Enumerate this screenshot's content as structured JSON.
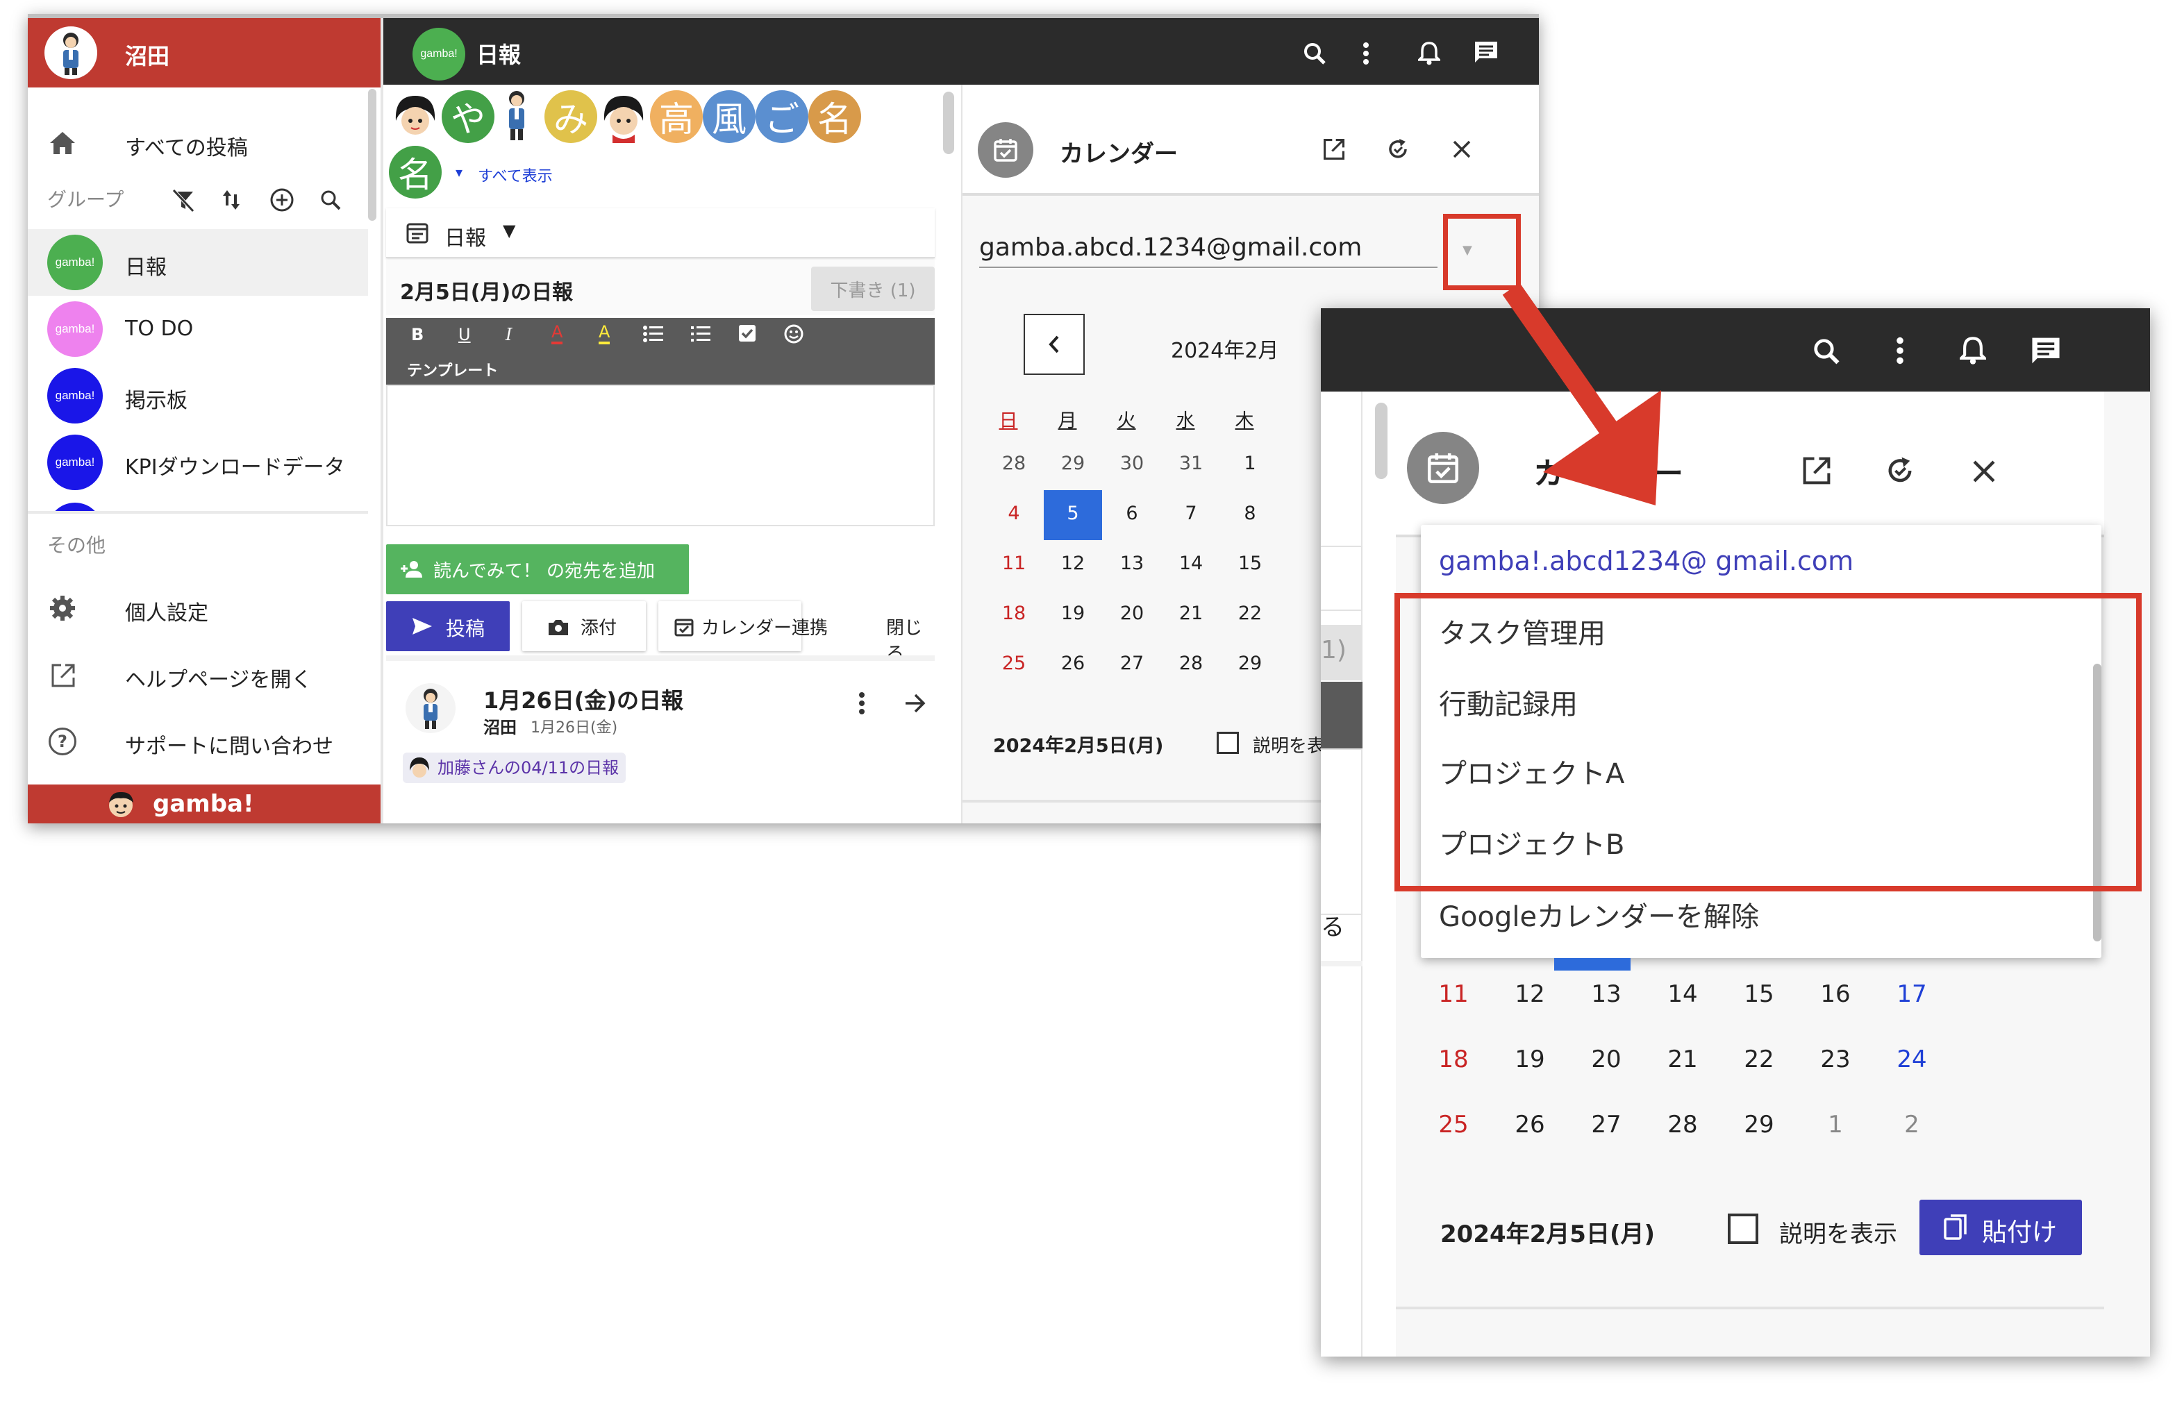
{
  "sidebar": {
    "user_name": "沼田",
    "all_posts": "すべての投稿",
    "group_header": "グループ",
    "groups": [
      {
        "name": "日報",
        "badge": "gamba!",
        "color": "#4caf50"
      },
      {
        "name": "TO DO",
        "badge": "gamba!",
        "color": "#ee82ee"
      },
      {
        "name": "掲示板",
        "badge": "gamba!",
        "color": "#1a16e8"
      },
      {
        "name": "KPIダウンロードデータ",
        "badge": "gamba!",
        "color": "#1a16e8"
      }
    ],
    "other_header": "その他",
    "personal_settings": "個人設定",
    "help_page": "ヘルプページを開く",
    "support": "サポートに問い合わせ",
    "footer_logo": "gamba!"
  },
  "topbar": {
    "group_badge": "gamba!",
    "group_title": "日報"
  },
  "feed": {
    "avatars": [
      "や",
      "み",
      "高",
      "風",
      "ご",
      "名",
      "名"
    ],
    "show_all": "すべて表示",
    "post_type": "日報",
    "editor_title": "2月5日(月)の日報",
    "draft_button": "下書き (1)",
    "toolbar_template": "テンプレート",
    "add_recipient": "読んでみて！ の宛先を追加",
    "post_button": "投稿",
    "attach_button": "添付",
    "calendar_link_button": "カレンダー連携",
    "close_button": "閉じる",
    "post_card": {
      "title": "1月26日(金)の日報",
      "author": "沼田",
      "date": "1月26日(金)",
      "tag": "加藤さんの04/11の日報"
    }
  },
  "calendar": {
    "title": "カレンダー",
    "account": "gamba.abcd.1234@gmail.com",
    "month_label": "2024年2月",
    "weekdays": [
      "日",
      "月",
      "火",
      "水",
      "木"
    ],
    "rows": [
      [
        "28",
        "29",
        "30",
        "31",
        "1"
      ],
      [
        "4",
        "5",
        "6",
        "7",
        "8"
      ],
      [
        "11",
        "12",
        "13",
        "14",
        "15"
      ],
      [
        "18",
        "19",
        "20",
        "21",
        "22"
      ],
      [
        "25",
        "26",
        "27",
        "28",
        "29"
      ]
    ],
    "selected_day": "5",
    "selected_date": "2024年2月5日(月)",
    "show_desc": "説明を表",
    "accent_color": "#2d6bdb"
  },
  "zoom": {
    "title_partial_a": "カ",
    "title_partial_b": "ー",
    "dropdown_account": "gamba!.abcd1234@ gmail.com",
    "menu_items": [
      "タスク管理用",
      "行動記録用",
      "プロジェクトA",
      "プロジェクトB"
    ],
    "unlink": "Googleカレンダーを解除",
    "side_fragment_a": "1)",
    "side_fragment_b": "る",
    "rows": [
      [
        "11",
        "12",
        "13",
        "14",
        "15",
        "16",
        "17"
      ],
      [
        "18",
        "19",
        "20",
        "21",
        "22",
        "23",
        "24"
      ],
      [
        "25",
        "26",
        "27",
        "28",
        "29",
        "1",
        "2"
      ]
    ],
    "selected_date": "2024年2月5日(月)",
    "show_desc": "説明を表示",
    "paste_button": "貼付け",
    "highlight_color": "#d83a2b"
  }
}
